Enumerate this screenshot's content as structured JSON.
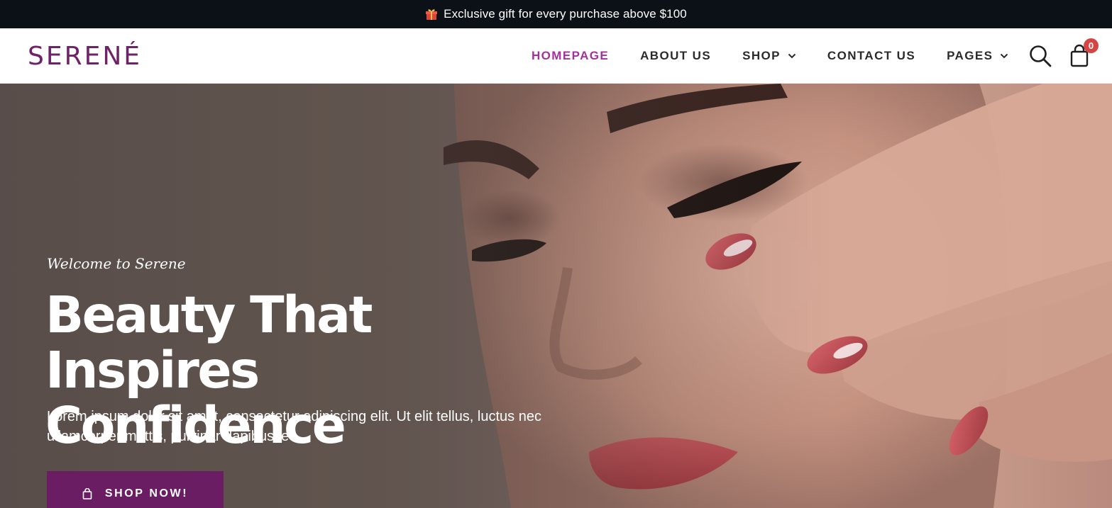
{
  "announcement": {
    "icon": "gift-icon",
    "text": "Exclusive gift for every purchase above $100"
  },
  "header": {
    "logo": "SERENÉ",
    "nav": [
      {
        "label": "HOMEPAGE",
        "active": true,
        "dropdown": false
      },
      {
        "label": "ABOUT US",
        "active": false,
        "dropdown": false
      },
      {
        "label": "SHOP",
        "active": false,
        "dropdown": true
      },
      {
        "label": "CONTACT US",
        "active": false,
        "dropdown": false
      },
      {
        "label": "PAGES",
        "active": false,
        "dropdown": true
      }
    ],
    "search_icon": "search-icon",
    "cart_icon": "shopping-bag-icon",
    "cart_count": "0"
  },
  "hero": {
    "eyebrow": "Welcome to Serene",
    "headline_line1": "Beauty That Inspires",
    "headline_line2": "Confidence",
    "description": "Lorem ipsum dolor sit amet, consectetur adipiscing elit. Ut elit tellus, luctus nec ullamcorper mattis, pulvinar dapibus leo.",
    "cta_label": "SHOP NOW!",
    "cta_icon": "shopping-bag-icon"
  },
  "colors": {
    "brand": "#6d2269",
    "active_nav": "#a4319b",
    "topbar_bg": "#0b1116",
    "cta_bg": "#6a1d63",
    "badge": "#d64545"
  }
}
